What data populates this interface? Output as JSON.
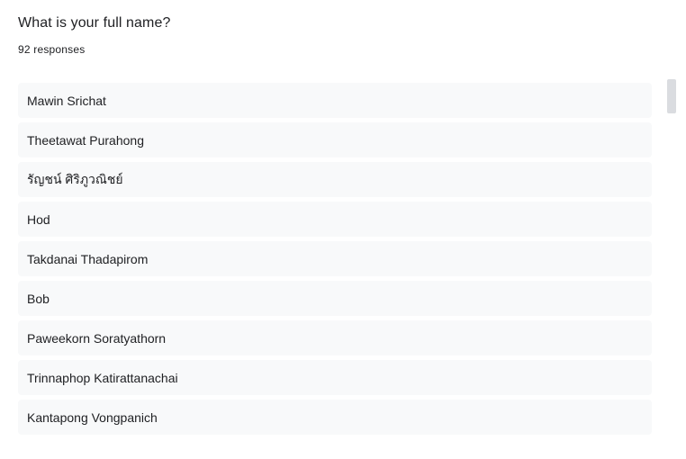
{
  "question": {
    "title": "What is your full name?",
    "response_count": "92 responses"
  },
  "responses": [
    "Mawin Srichat",
    "Theetawat Purahong",
    "รัญชน์ ศิริภูวณิชย์",
    "Hod",
    "Takdanai Thadapirom",
    "Bob",
    "Paweekorn Soratyathorn",
    "Trinnaphop Katirattanachai",
    "Kantapong Vongpanich"
  ]
}
